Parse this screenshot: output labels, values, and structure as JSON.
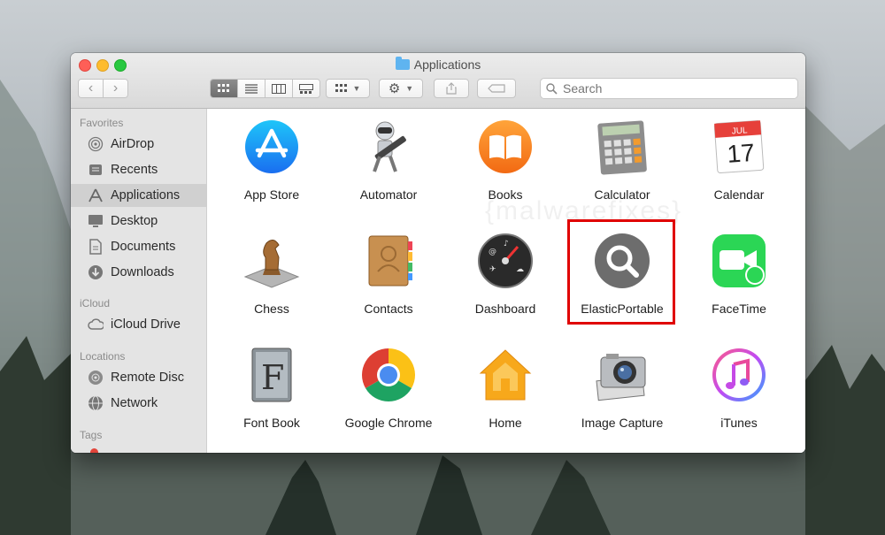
{
  "window": {
    "title": "Applications"
  },
  "toolbar": {
    "search_placeholder": "Search"
  },
  "sidebar": {
    "favorites_title": "Favorites",
    "favorites": [
      {
        "label": "AirDrop",
        "icon": "airdrop-icon"
      },
      {
        "label": "Recents",
        "icon": "recents-icon"
      },
      {
        "label": "Applications",
        "icon": "applications-icon",
        "selected": true
      },
      {
        "label": "Desktop",
        "icon": "desktop-icon"
      },
      {
        "label": "Documents",
        "icon": "documents-icon"
      },
      {
        "label": "Downloads",
        "icon": "downloads-icon"
      }
    ],
    "icloud_title": "iCloud",
    "icloud": [
      {
        "label": "iCloud Drive",
        "icon": "cloud-icon"
      }
    ],
    "locations_title": "Locations",
    "locations": [
      {
        "label": "Remote Disc",
        "icon": "disc-icon"
      },
      {
        "label": "Network",
        "icon": "network-icon"
      }
    ],
    "tags_title": "Tags"
  },
  "apps": [
    {
      "label": "App Store"
    },
    {
      "label": "Automator"
    },
    {
      "label": "Books"
    },
    {
      "label": "Calculator"
    },
    {
      "label": "Calendar",
      "month": "JUL",
      "day": "17"
    },
    {
      "label": "Chess"
    },
    {
      "label": "Contacts"
    },
    {
      "label": "Dashboard"
    },
    {
      "label": "ElasticPortable"
    },
    {
      "label": "FaceTime"
    },
    {
      "label": "Font Book"
    },
    {
      "label": "Google Chrome"
    },
    {
      "label": "Home"
    },
    {
      "label": "Image Capture"
    },
    {
      "label": "iTunes"
    }
  ],
  "highlight_color": "#e00000",
  "watermark": "{malwarefixes}"
}
